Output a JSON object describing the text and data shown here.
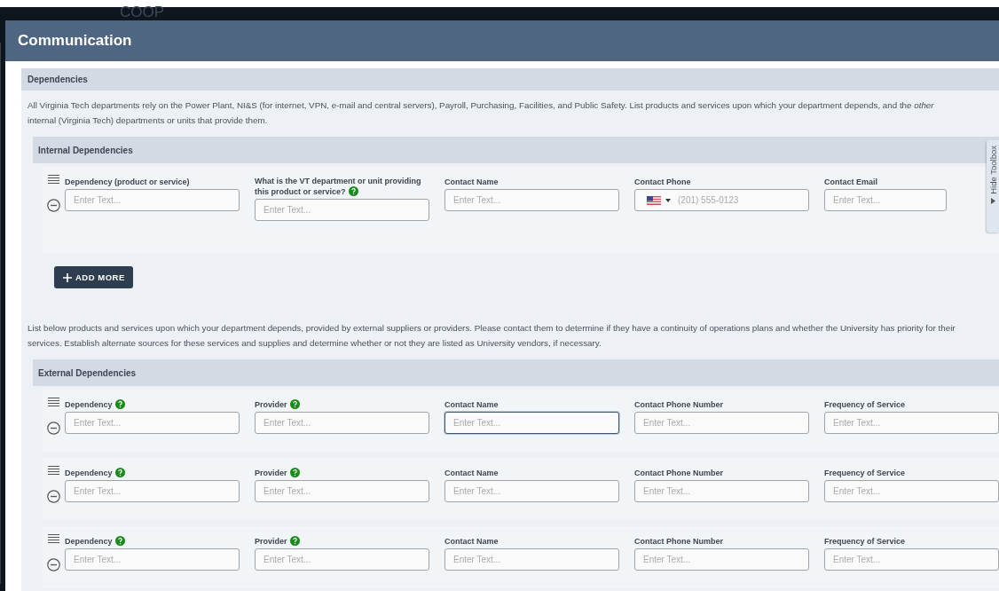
{
  "background": {
    "app_title": "COOP"
  },
  "dialog": {
    "title": "Communication"
  },
  "section": {
    "title": "Dependencies",
    "intro": "All Virginia Tech departments rely on the Power Plant, NI&S (for internet, VPN, e-mail and central servers), Payroll, Purchasing, Facilities, and Public Safety. List products and services upon which your department depends, and the *other* internal (Virginia Tech) departments or units that provide them."
  },
  "internal": {
    "title": "Internal Dependencies",
    "rows": [
      {
        "fields": [
          {
            "kind": "text",
            "label": "Dependency (product or service)",
            "help": false,
            "placeholder": "Enter Text...",
            "focused": false
          },
          {
            "kind": "text",
            "label": "What is the VT department or unit providing this product or service?",
            "help": true,
            "placeholder": "Enter Text...",
            "focused": false
          },
          {
            "kind": "text",
            "label": "Contact Name",
            "help": false,
            "placeholder": "Enter Text...",
            "focused": false
          },
          {
            "kind": "phone",
            "label": "Contact Phone",
            "help": false,
            "placeholder": "(201) 555-0123"
          },
          {
            "kind": "text",
            "label": "Contact Email",
            "help": false,
            "placeholder": "Enter Text...",
            "focused": false
          }
        ]
      }
    ],
    "add_button": "ADD MORE"
  },
  "external_intro": "List below products and services upon which your department depends, provided by external suppliers or providers. Please contact them to determine if they have a continuity of operations plans and whether the University has priority for their services.   Establish alternate sources for these services and supplies and determine whether or not they are listed as University vendors, if necessary.",
  "external": {
    "title": "External Dependencies",
    "rows": [
      {
        "fields": [
          {
            "kind": "text",
            "label": "Dependency",
            "help": true,
            "placeholder": "Enter Text...",
            "focused": false
          },
          {
            "kind": "text",
            "label": "Provider",
            "help": true,
            "placeholder": "Enter Text...",
            "focused": false
          },
          {
            "kind": "text",
            "label": "Contact Name",
            "help": false,
            "placeholder": "Enter Text...",
            "focused": true
          },
          {
            "kind": "text",
            "label": "Contact Phone Number",
            "help": false,
            "placeholder": "Enter Text...",
            "focused": false
          },
          {
            "kind": "text",
            "label": "Frequency of Service",
            "help": false,
            "placeholder": "Enter Text...",
            "focused": false
          }
        ]
      },
      {
        "fields": [
          {
            "kind": "text",
            "label": "Dependency",
            "help": true,
            "placeholder": "Enter Text...",
            "focused": false
          },
          {
            "kind": "text",
            "label": "Provider",
            "help": true,
            "placeholder": "Enter Text...",
            "focused": false
          },
          {
            "kind": "text",
            "label": "Contact Name",
            "help": false,
            "placeholder": "Enter Text...",
            "focused": false
          },
          {
            "kind": "text",
            "label": "Contact Phone Number",
            "help": false,
            "placeholder": "Enter Text...",
            "focused": false
          },
          {
            "kind": "text",
            "label": "Frequency of Service",
            "help": false,
            "placeholder": "Enter Text...",
            "focused": false
          }
        ]
      },
      {
        "fields": [
          {
            "kind": "text",
            "label": "Dependency",
            "help": true,
            "placeholder": "Enter Text...",
            "focused": false
          },
          {
            "kind": "text",
            "label": "Provider",
            "help": true,
            "placeholder": "Enter Text...",
            "focused": false
          },
          {
            "kind": "text",
            "label": "Contact Name",
            "help": false,
            "placeholder": "Enter Text...",
            "focused": false
          },
          {
            "kind": "text",
            "label": "Contact Phone Number",
            "help": false,
            "placeholder": "Enter Text...",
            "focused": false
          },
          {
            "kind": "text",
            "label": "Frequency of Service",
            "help": false,
            "placeholder": "Enter Text...",
            "focused": false
          }
        ]
      }
    ]
  },
  "toolbox": {
    "label": "Hide Toolbox"
  }
}
